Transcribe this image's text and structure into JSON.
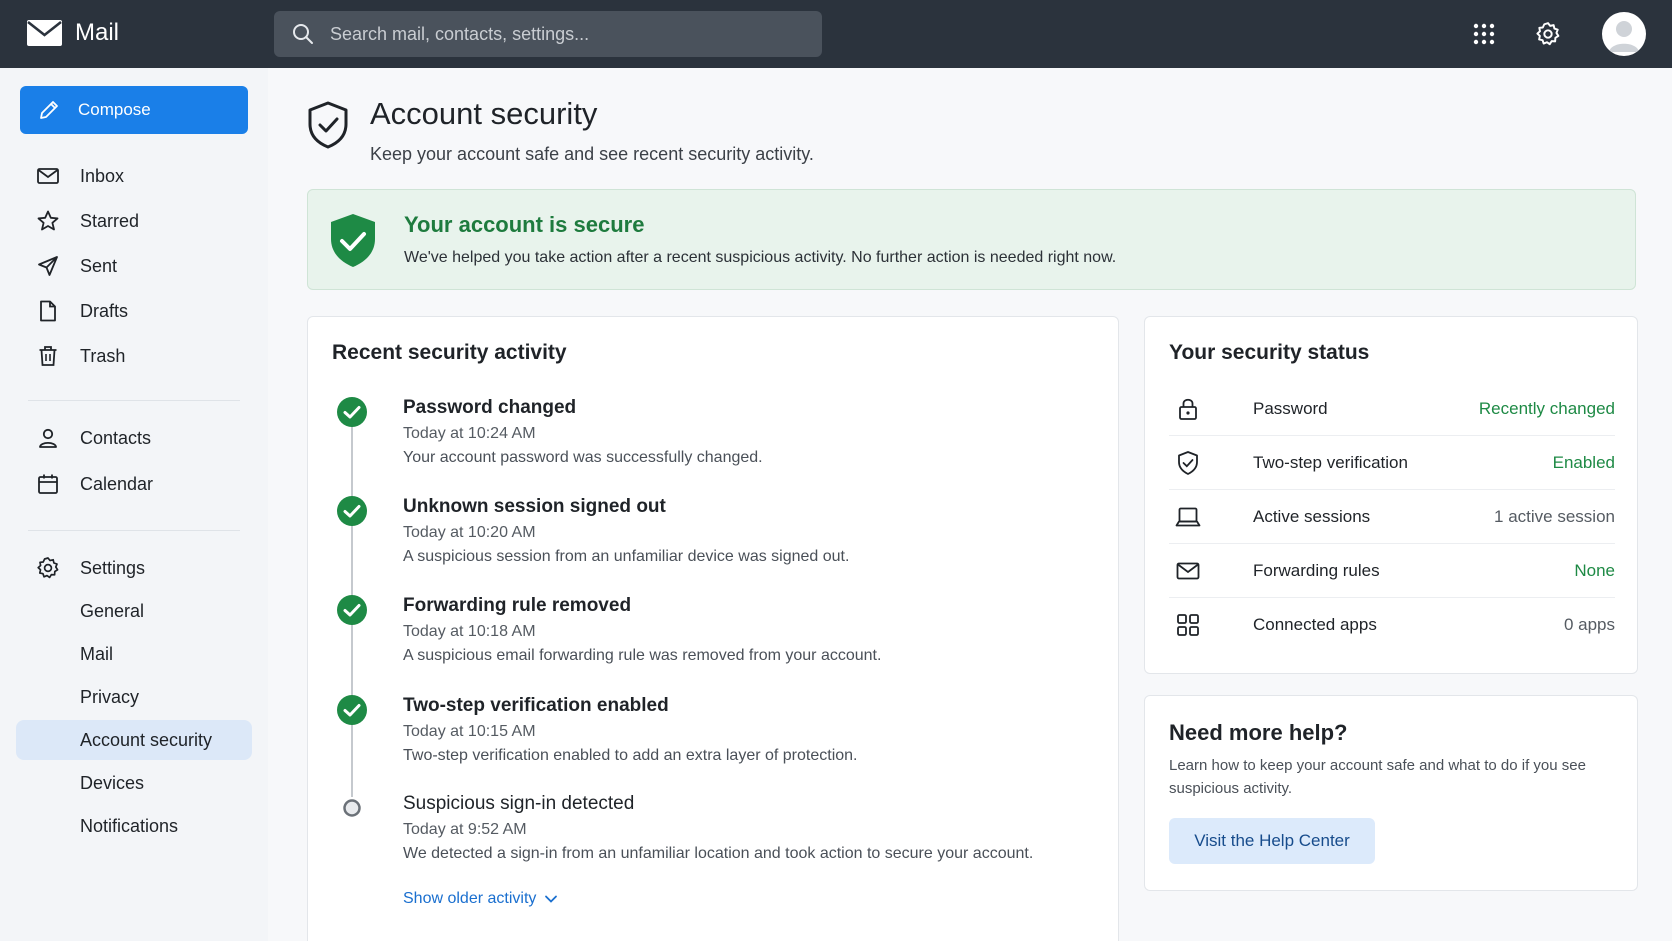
{
  "app": {
    "name": "Mail"
  },
  "search": {
    "placeholder": "Search mail, contacts, settings..."
  },
  "header_icons": [
    "apps-grid-icon",
    "gear-icon",
    "avatar-icon"
  ],
  "sidebar": {
    "compose_label": "Compose",
    "items": [
      {
        "label": "Inbox",
        "icon": "inbox-icon"
      },
      {
        "label": "Starred",
        "icon": "star-icon"
      },
      {
        "label": "Sent",
        "icon": "send-icon"
      },
      {
        "label": "Drafts",
        "icon": "draft-icon"
      },
      {
        "label": "Trash",
        "icon": "trash-icon"
      },
      {
        "label": "Contacts",
        "icon": "person-icon"
      },
      {
        "label": "Calendar",
        "icon": "calendar-icon"
      },
      {
        "label": "Settings",
        "icon": "gear-icon"
      }
    ],
    "settings_sub": [
      {
        "label": "General"
      },
      {
        "label": "Mail"
      },
      {
        "label": "Privacy"
      },
      {
        "label": "Account security",
        "active": true
      },
      {
        "label": "Devices"
      },
      {
        "label": "Notifications"
      }
    ]
  },
  "page": {
    "title": "Account security",
    "subtitle": "Keep your account safe and see recent security activity."
  },
  "banner": {
    "title": "Your account is secure",
    "text": "We've helped you take action after a recent suspicious activity. No further action is needed right now."
  },
  "activity": {
    "title": "Recent security activity",
    "items": [
      {
        "title": "Password changed",
        "time": "Today at 10:24 AM",
        "desc": "Your account password was successfully changed.",
        "status": "done"
      },
      {
        "title": "Unknown session signed out",
        "time": "Today at 10:20 AM",
        "desc": "A suspicious session from an unfamiliar device was signed out.",
        "status": "done"
      },
      {
        "title": "Forwarding rule removed",
        "time": "Today at 10:18 AM",
        "desc": "A suspicious email forwarding rule was removed from your account.",
        "status": "done"
      },
      {
        "title": "Two-step verification enabled",
        "time": "Today at 10:15 AM",
        "desc": "Two-step verification enabled to add an extra layer of protection.",
        "status": "done"
      },
      {
        "title": "Suspicious sign-in detected",
        "time": "Today at 9:52 AM",
        "desc": "We detected a sign-in from an unfamiliar location and took action to secure your account.",
        "status": "pending"
      }
    ],
    "show_older": "Show older activity"
  },
  "status": {
    "title": "Your security status",
    "rows": [
      {
        "label": "Password",
        "value": "Recently changed",
        "icon": "lock-icon",
        "tone": "green"
      },
      {
        "label": "Two-step verification",
        "value": "Enabled",
        "icon": "shield-check-icon",
        "tone": "green"
      },
      {
        "label": "Active sessions",
        "value": "1 active session",
        "icon": "laptop-icon",
        "tone": "muted"
      },
      {
        "label": "Forwarding rules",
        "value": "None",
        "icon": "mail-icon",
        "tone": "green"
      },
      {
        "label": "Connected apps",
        "value": "0 apps",
        "icon": "apps-icon",
        "tone": "muted"
      }
    ]
  },
  "help": {
    "title": "Need more help?",
    "text": "Learn how to keep your account safe and what to do if you see suspicious activity.",
    "button": "Visit the Help Center"
  },
  "colors": {
    "topbar": "#2b333d",
    "accent": "#1a7fe8",
    "success": "#1e8a45",
    "active_nav": "#dce8f8"
  }
}
